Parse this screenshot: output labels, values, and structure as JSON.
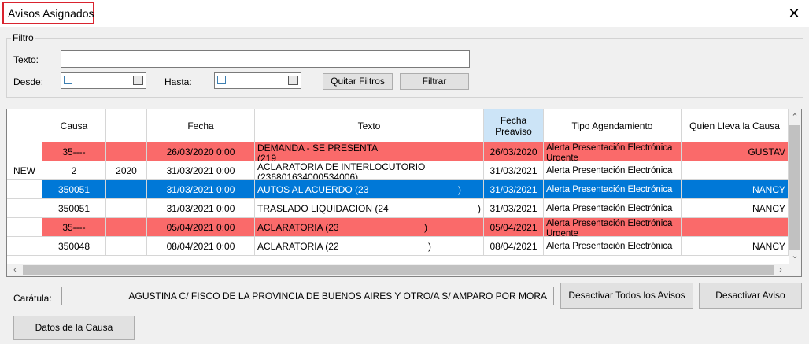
{
  "window": {
    "title": "Avisos Asignados",
    "close_glyph": "✕"
  },
  "filter": {
    "legend": "Filtro",
    "texto_label": "Texto:",
    "texto_value": "",
    "desde_label": "Desde:",
    "hasta_label": "Hasta:",
    "quitar_label": "Quitar Filtros",
    "filtrar_label": "Filtrar"
  },
  "grid": {
    "headers": [
      "",
      "Causa",
      "",
      "Fecha",
      "Texto",
      "Fecha Preaviso",
      "Tipo Agendamiento",
      "Quien Lleva la Causa"
    ],
    "rows": [
      {
        "style": "red",
        "cells": [
          "",
          "35----",
          "",
          "26/03/2020 0:00",
          "DEMANDA - SE PRESENTA",
          "26/03/2020",
          "Alerta Presentación Electrónica",
          "GUSTAV"
        ],
        "texto_sub": "(219",
        "tipo_sub": "Urgente"
      },
      {
        "style": "white",
        "cells": [
          "NEW",
          "2",
          "2020",
          "31/03/2021 0:00",
          "ACLARATORIA DE INTERLOCUTORIO",
          "31/03/2021",
          "Alerta Presentación Electrónica",
          ""
        ],
        "texto_sub": "(236801634000534006)",
        "tipo_sub": ""
      },
      {
        "style": "blue",
        "cells": [
          "",
          "350051",
          "",
          "31/03/2021 0:00",
          "AUTOS AL ACUERDO (23",
          "31/03/2021",
          "Alerta Presentación Electrónica",
          "NANCY"
        ],
        "texto_end": ")"
      },
      {
        "style": "white",
        "cells": [
          "",
          "350051",
          "",
          "31/03/2021 0:00",
          "TRASLADO LIQUIDACION (24",
          "31/03/2021",
          "Alerta Presentación Electrónica",
          "NANCY"
        ],
        "texto_end": ")"
      },
      {
        "style": "red",
        "cells": [
          "",
          "35----",
          "",
          "05/04/2021 0:00",
          "ACLARATORIA (23",
          "05/04/2021",
          "Alerta Presentación Electrónica",
          ""
        ],
        "texto_end": ")",
        "tipo_sub": "Urgente"
      },
      {
        "style": "white",
        "cells": [
          "",
          "350048",
          "",
          "08/04/2021 0:00",
          "ACLARATORIA (22",
          "08/04/2021",
          "Alerta Presentación Electrónica",
          "NANCY"
        ],
        "texto_end": ")"
      }
    ]
  },
  "caratula": {
    "label": "Carátula:",
    "value": "AGUSTINA C/ FISCO DE LA PROVINCIA DE BUENOS AIRES Y OTRO/A S/ AMPARO POR MORA"
  },
  "buttons": {
    "desactivar_todos": "Desactivar Todos los Avisos",
    "desactivar": "Desactivar Aviso",
    "datos_causa": "Datos de la Causa"
  },
  "colors": {
    "red_row": "#fa6a6a",
    "blue_row": "#0078d7",
    "header_highlight": "#cce4f7",
    "title_border": "#d9232e"
  }
}
